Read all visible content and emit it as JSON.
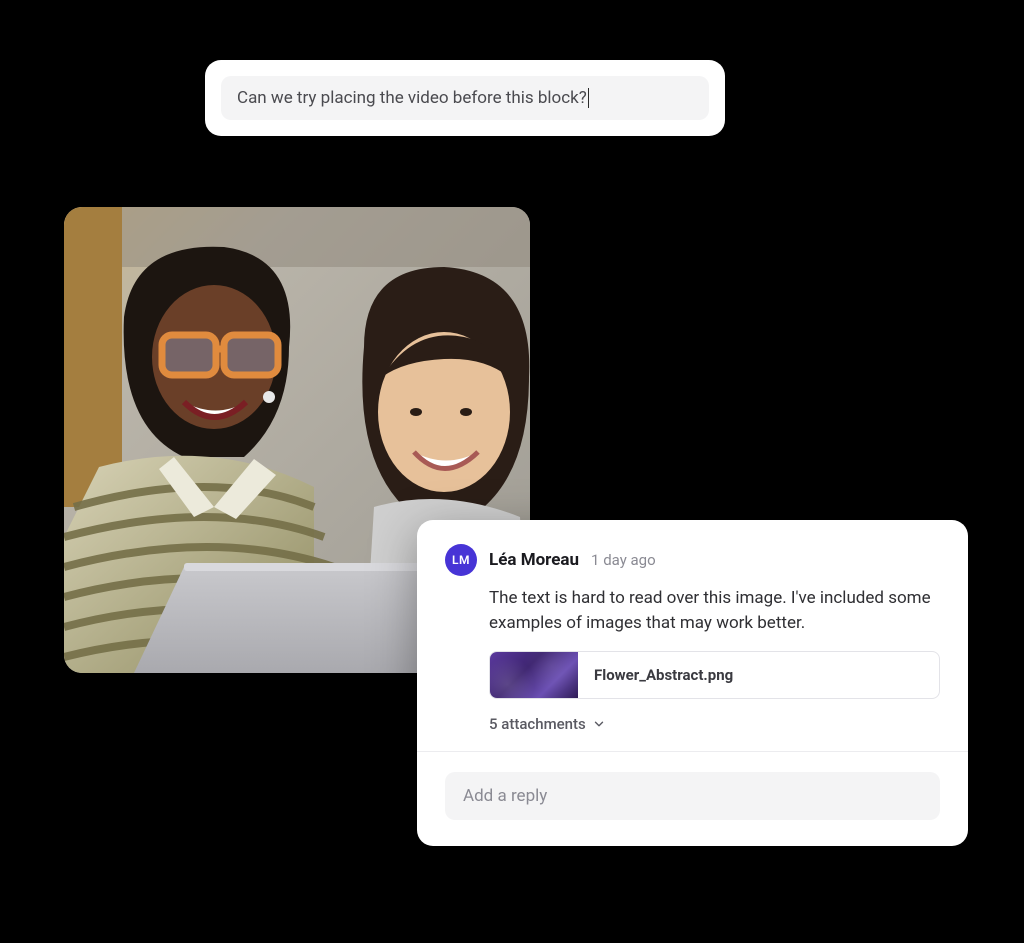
{
  "compose": {
    "text": "Can we try placing the video before this block?"
  },
  "comment": {
    "avatar_initials": "LM",
    "author": "Léa Moreau",
    "timestamp": "1 day ago",
    "text": "The text is hard to read over this image. I've included some examples of images that may work better.",
    "attachment_name": "Flower_Abstract.png",
    "attachments_count_label": "5 attachments",
    "reply_placeholder": "Add a reply"
  },
  "colors": {
    "avatar_bg": "#4734d6",
    "panel_bg": "#ffffff"
  }
}
